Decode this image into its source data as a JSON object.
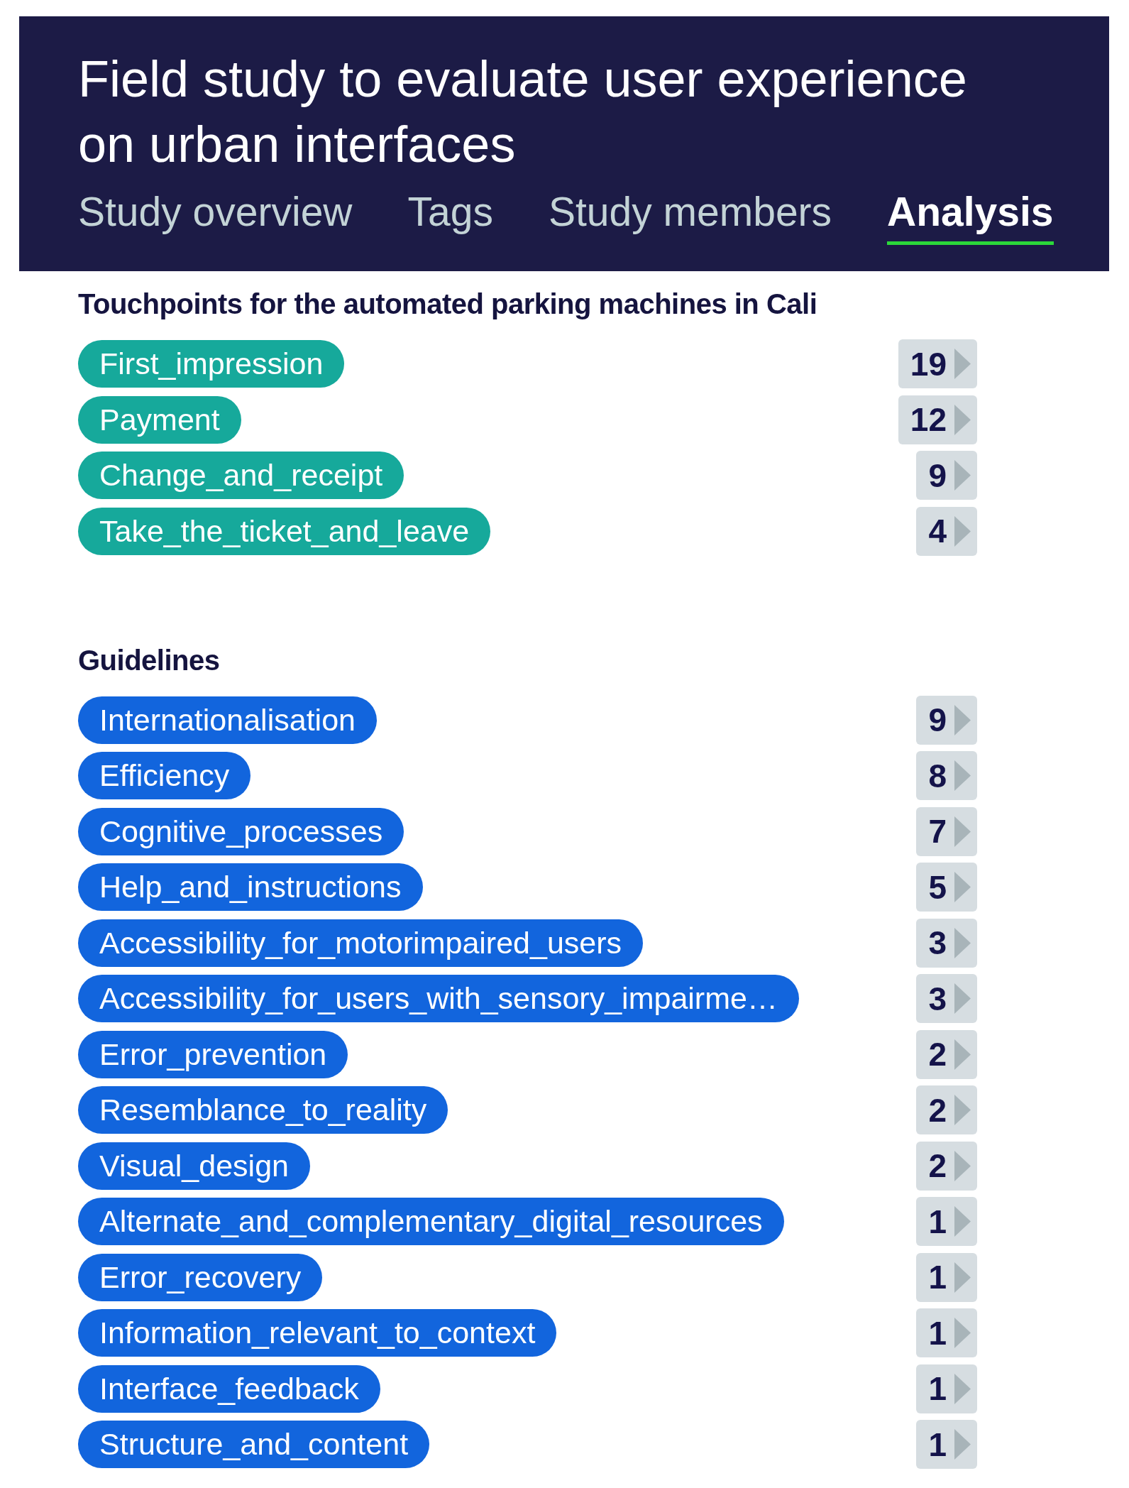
{
  "header": {
    "title": "Field study to evaluate user experience on urban interfaces",
    "tabs": [
      {
        "label": "Study overview",
        "selected": false
      },
      {
        "label": "Tags",
        "selected": false
      },
      {
        "label": "Study members",
        "selected": false
      },
      {
        "label": "Analysis",
        "selected": true
      }
    ]
  },
  "sections": [
    {
      "title": "Touchpoints for the automated parking machines in Cali",
      "color": "#16a99b",
      "tags": [
        {
          "label": "First_impression",
          "count": "19"
        },
        {
          "label": "Payment",
          "count": "12"
        },
        {
          "label": "Change_and_receipt",
          "count": "9"
        },
        {
          "label": "Take_the_ticket_and_leave",
          "count": "4"
        }
      ]
    },
    {
      "title": "Guidelines",
      "color": "#1265dd",
      "tags": [
        {
          "label": "Internationalisation",
          "count": "9"
        },
        {
          "label": "Efficiency",
          "count": "8"
        },
        {
          "label": "Cognitive_processes",
          "count": "7"
        },
        {
          "label": "Help_and_instructions",
          "count": "5"
        },
        {
          "label": "Accessibility_for_motorimpaired_users",
          "count": "3"
        },
        {
          "label": "Accessibility_for_users_with_sensory_impairme…",
          "count": "3"
        },
        {
          "label": "Error_prevention",
          "count": "2"
        },
        {
          "label": "Resemblance_to_reality",
          "count": "2"
        },
        {
          "label": "Visual_design",
          "count": "2"
        },
        {
          "label": "Alternate_and_complementary_digital_resources",
          "count": "1"
        },
        {
          "label": "Error_recovery",
          "count": "1"
        },
        {
          "label": "Information_relevant_to_context",
          "count": "1"
        },
        {
          "label": "Interface_feedback",
          "count": "1"
        },
        {
          "label": "Structure_and_content",
          "count": "1"
        }
      ]
    }
  ]
}
